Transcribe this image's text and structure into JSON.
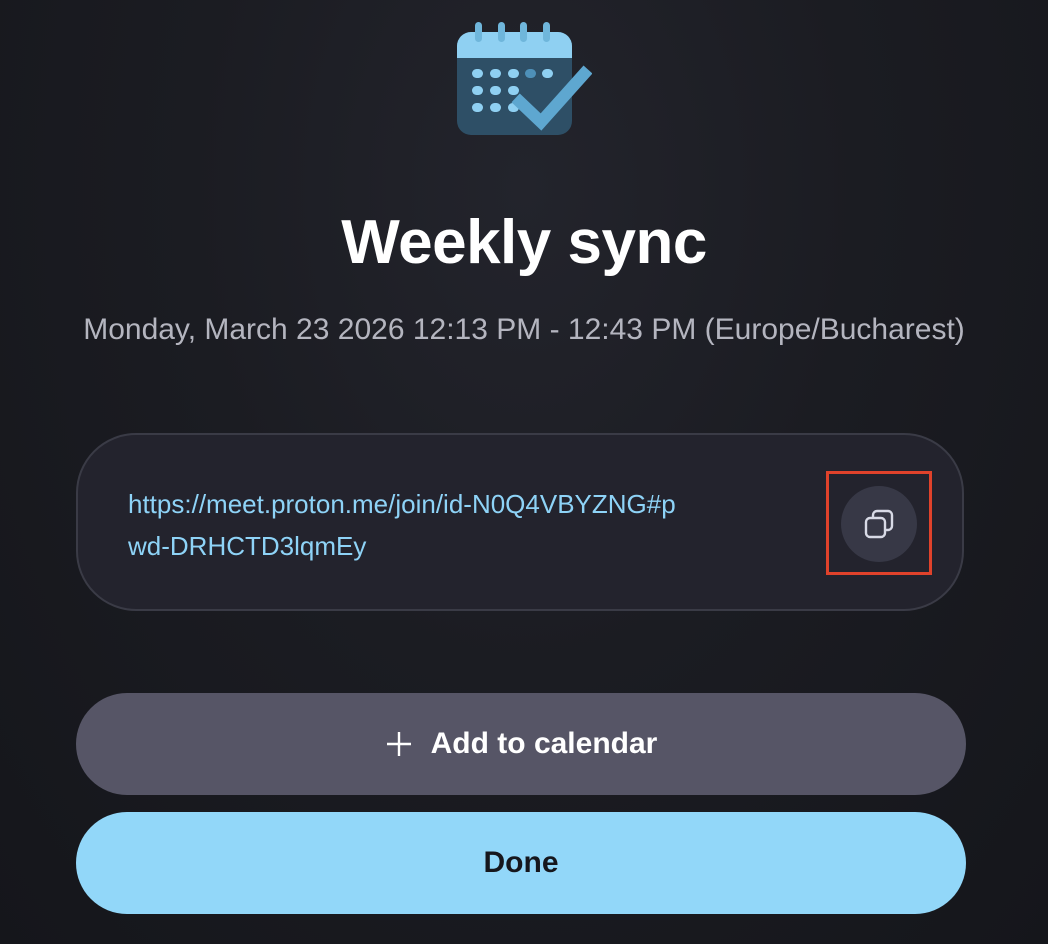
{
  "meeting": {
    "title": "Weekly sync",
    "datetime": "Monday, March 23 2026 12:13 PM - 12:43 PM (Europe/Bucharest)",
    "link": "https://meet.proton.me/join/id-N0Q4VBYZNG#pwd-DRHCTD3lqmEy"
  },
  "actions": {
    "add_to_calendar_label": "Add to calendar",
    "done_label": "Done"
  },
  "icons": {
    "header": "calendar-check-icon",
    "copy": "copy-icon",
    "add": "plus-icon"
  },
  "colors": {
    "link": "#8ed3f7",
    "primary_button": "#92d7f9",
    "secondary_button": "#565566",
    "highlight_frame": "#e0422b"
  }
}
